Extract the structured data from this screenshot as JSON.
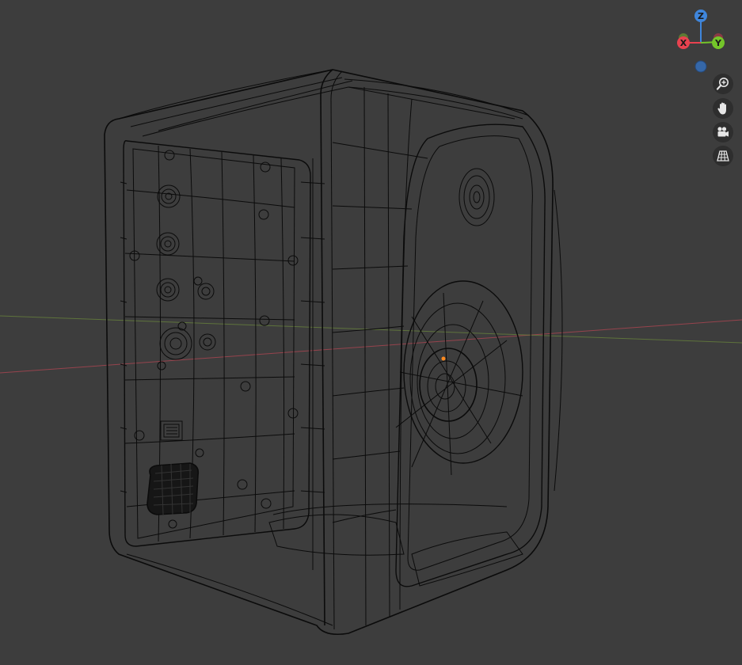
{
  "viewport": {
    "mode": "wireframe",
    "background_color": "#3d3d3d",
    "wire_color": "#0b0b0b",
    "x_axis_line_color": "#a64550",
    "y_axis_line_color": "#6c8a3c",
    "origin_point_color": "#ff8a1e"
  },
  "gizmo": {
    "z_label": "Z",
    "x_label": "X",
    "y_label": "Y",
    "colors": {
      "x": "#e8424f",
      "y": "#74c52a",
      "z": "#3f86dc",
      "neg_z": "#3567a8"
    }
  },
  "tools": [
    {
      "name": "zoom",
      "icon": "zoom-icon"
    },
    {
      "name": "pan",
      "icon": "hand-icon"
    },
    {
      "name": "camera",
      "icon": "camera-icon"
    },
    {
      "name": "perspective",
      "icon": "grid-icon"
    }
  ]
}
